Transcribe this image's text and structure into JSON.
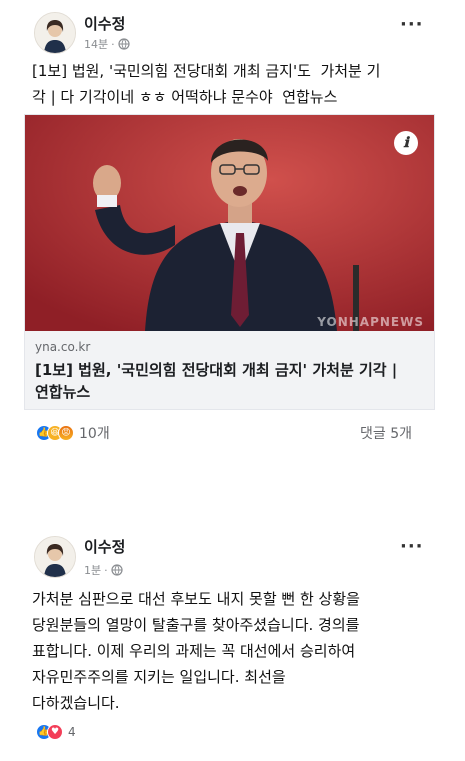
{
  "post1": {
    "author": "이수정",
    "time": "14분",
    "separator": "·",
    "text": "[1보] 법원, '국민의힘 전당대회 개최 금지'도  가처분 기\n각 | 다 기각이네 ㅎㅎ 어떡하냐 문수야  연합뉴스",
    "link": {
      "domain": "yna.co.kr",
      "title": "[1보] 법원, '국민의힘 전당대회 개최 금지' 가처분 기각 |\n연합뉴스",
      "watermark": "YONHAPNEWS",
      "info_icon": "ℹ"
    },
    "reactions": {
      "icons": [
        "like-icon",
        "haha-icon",
        "angry-icon"
      ],
      "count": "10개"
    },
    "comments": "댓글 5개"
  },
  "post2": {
    "author": "이수정",
    "time": "1분",
    "separator": "·",
    "text": "가처분 심판으로 대선 후보도 내지 못할 뻔 한 상황을\n당원분들의 열망이 탈출구를 찾아주셨습니다. 경의를\n표합니다. 이제 우리의 과제는 꼭 대선에서 승리하여\n자유민주주의를 지키는 일입니다. 최선을\n다하겠습니다.",
    "reactions": {
      "icons": [
        "like-icon",
        "love-icon"
      ],
      "count": "4"
    }
  },
  "more_label": "···",
  "colors": {
    "like": "#1877f2",
    "love": "#f33e58",
    "haha": "#f7b125",
    "link_bg": "#f2f3f5"
  }
}
